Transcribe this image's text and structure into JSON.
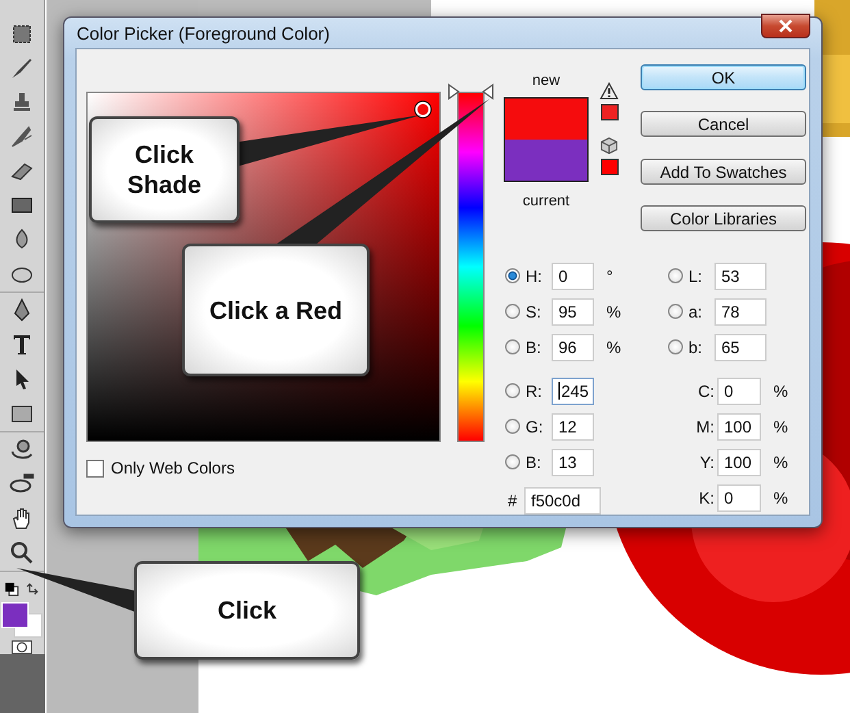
{
  "window": {
    "title": "Color Picker (Foreground Color)"
  },
  "swatches": [
    {
      "label": "new",
      "color": "#f50c0d"
    },
    {
      "label": "current",
      "color": "#7b2fbf"
    }
  ],
  "hue_slider": {
    "level": 1
  },
  "warnings": [
    {
      "kind": "gamut",
      "color": "#ee2222"
    },
    {
      "kind": "web",
      "color": "#ff0000"
    }
  ],
  "buttons": [
    {
      "label": "OK",
      "default": true
    },
    {
      "label": "Cancel",
      "default": false
    },
    {
      "label": "Add To Swatches",
      "default": false
    },
    {
      "label": "Color Libraries",
      "default": false
    }
  ],
  "left_fields": [
    {
      "label": "H:",
      "value": "0",
      "unit": "°",
      "selected": true,
      "focused": false
    },
    {
      "label": "S:",
      "value": "95",
      "unit": "%",
      "selected": false,
      "focused": false
    },
    {
      "label": "B:",
      "value": "96",
      "unit": "%",
      "selected": false,
      "focused": false
    },
    {
      "label": "R:",
      "value": "245",
      "selected": false,
      "focused": true
    },
    {
      "label": "G:",
      "value": "12",
      "selected": false,
      "focused": false
    },
    {
      "label": "B:",
      "value": "13",
      "selected": false,
      "focused": false
    }
  ],
  "hex": {
    "label": "#",
    "value": "f50c0d"
  },
  "right_fields": [
    {
      "kind": "radio",
      "label": "L:",
      "value": "53",
      "selected": false
    },
    {
      "kind": "radio",
      "label": "a:",
      "value": "78",
      "selected": false
    },
    {
      "kind": "radio",
      "label": "b:",
      "value": "65",
      "selected": false
    },
    {
      "kind": "plain",
      "label": "C:",
      "value": "0",
      "unit": "%"
    },
    {
      "kind": "plain",
      "label": "M:",
      "value": "100",
      "unit": "%"
    },
    {
      "kind": "plain",
      "label": "Y:",
      "value": "100",
      "unit": "%"
    },
    {
      "kind": "plain",
      "label": "K:",
      "value": "0",
      "unit": "%"
    }
  ],
  "only_web_colors": {
    "label": "Only Web Colors",
    "checked": false
  },
  "callouts": [
    {
      "lines": [
        "Click",
        "Shade"
      ]
    },
    {
      "lines": [
        "Click a Red"
      ]
    },
    {
      "lines": [
        "Click"
      ]
    }
  ]
}
